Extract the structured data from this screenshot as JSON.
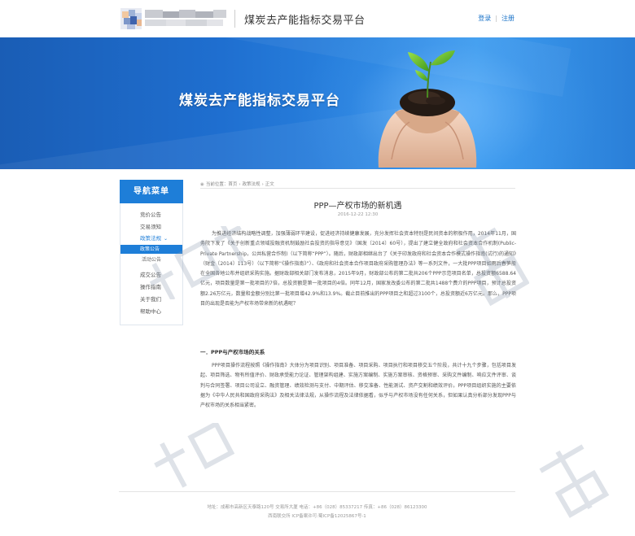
{
  "header": {
    "site_title": "煤炭去产能指标交易平台",
    "login": "登录",
    "separator": "|",
    "register": "注册"
  },
  "banner": {
    "title": "煤炭去产能指标交易平台"
  },
  "sidebar": {
    "title": "导航菜单",
    "items": [
      {
        "label": "竞价公告"
      },
      {
        "label": "交易须知"
      },
      {
        "label": "政策法规",
        "expanded": true
      },
      {
        "label": "政策公告"
      },
      {
        "label": "活动公告"
      },
      {
        "label": "成交公告"
      },
      {
        "label": "操作指南"
      },
      {
        "label": "关于我们"
      },
      {
        "label": "帮助中心"
      }
    ],
    "chevron": "⌄"
  },
  "breadcrumb": {
    "prefix": "当前位置：",
    "home": "首页",
    "sep": "›",
    "section": "政策法规",
    "current": "正文"
  },
  "article": {
    "title": "PPP—产权市场的新机遇",
    "date": "2016-12-22 12:30",
    "para1": "为推进经济结构战略性调整，加强薄弱环节建设，促进经济持续健康发展，充分发挥社会资本特别是民间资本的积极作用，2014年11月，国务院下发了《关于创新重点领域投融资机制鼓励社会投资的指导意见》（国发〔2014〕60号），提出了建立健全政府和社会资本合作机制(Public-Private Partnership，公共私营合作制)（以下简称“PPP”）。随后，财政部相继出台了《关于印发政府和社会资本合作模式操作指南(试行)的通知》（财金〔2014〕113号）（以下简称“《操作指南》”）、《政府和社会资本合作项目政府采购管理办法》等一系列文件，一大批PPP项目如雨后春笋般在全国各地公布并组织采购实施。据财政部相关部门发布消息，2015年9月，财政部公布的第二批共206个PPP示范项目名单，总投资额6588.64亿元，项目数量是第一批项目的7倍，总投资额是第一批项目的4倍。同年12月，国家发改委公布的第二批共1488个费介的PPP项目，预计总投资额2.26万亿元，数量和金额分别比第一批项目增42.9%和13.9%。截止目前推出的PPP项目之和超过3100个，总投资额近6万亿元。那么，PPP项目的出现是否能为产权市场带来新的机遇呢？",
    "section_heading": "一．PPP与产权市场的关系",
    "para2": "PPP项目操作流程按照《操作指南》大体分为项目识别、项目准备、项目采购、项目执行和项目移交五个阶段，共计十九个步骤，包括项目发起、项目筛选、物有所值评价、财政承受能力论证、管理架构组建、实施方案编制、实施方案审核、资格预审、采购文件编制、响应文件评审、谈判与合同签署、项目公司设立、融资管理、绩效检测与支付、中期评估、移交准备、性能测试、资产交割和绩效评价。PPP项目组织实施的主要依据为《中华人民共和国政府采购法》及相关法律法规，从操作流程及法律依据看，似乎与产权市场没有任何关系，但如果认真分析部分发现PPP与产权市场的关系相当紧密。"
  },
  "footer": {
    "line1": "地址：成都市高新区天泰路120号 交易所大厦  电话：+86（028）85337217  传真：+86（028）86123300",
    "line2": "西南联交所    ICP备案许可:蜀ICP备12025867号-1"
  },
  "colors": {
    "accent": "#1e7ed8",
    "banner_dark": "#1a5db5",
    "banner_light": "#3c9cf0"
  }
}
